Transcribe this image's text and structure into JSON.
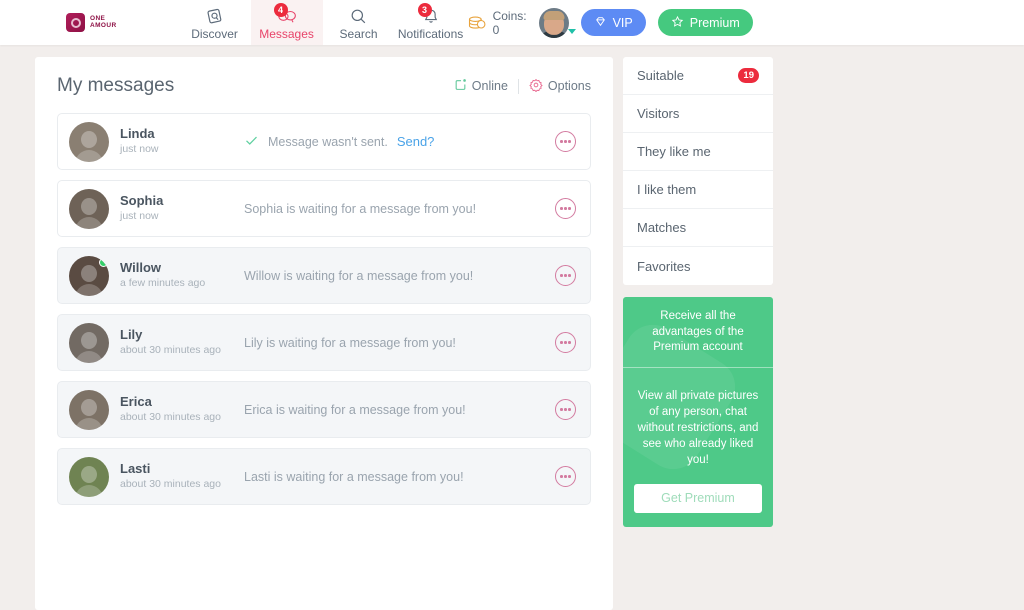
{
  "header": {
    "logo": {
      "line1": "ONE",
      "line2": "AMOUR",
      "icon": "one-amour-logo-icon"
    },
    "nav": [
      {
        "label": "Discover",
        "icon": "discover-icon",
        "badge": null,
        "active": false
      },
      {
        "label": "Messages",
        "icon": "messages-icon",
        "badge": "4",
        "active": true
      },
      {
        "label": "Search",
        "icon": "search-icon",
        "badge": null,
        "active": false
      },
      {
        "label": "Notifications",
        "icon": "bell-icon",
        "badge": "3",
        "active": false
      }
    ],
    "coins": {
      "label": "Coins: 0",
      "icon": "coins-icon"
    },
    "account": {
      "avatar": "user-avatar",
      "caret": "chevron-down-icon"
    },
    "vip_button": {
      "label": "VIP",
      "icon": "diamond-icon",
      "color": "#5d8bf4"
    },
    "premium_button": {
      "label": "Premium",
      "icon": "star-icon",
      "color": "#45c97f"
    }
  },
  "main": {
    "title": "My messages",
    "actions": [
      {
        "label": "Online",
        "icon": "online-toggle-icon",
        "color": "#62c89b"
      },
      {
        "label": "Options",
        "icon": "gear-icon",
        "color": "#e8688f"
      }
    ],
    "messages": [
      {
        "name": "Linda",
        "time": "just now",
        "text": "Message wasn't sent.",
        "link": "Send?",
        "check": true,
        "online": false,
        "unseen": false,
        "avatar_color": "#8a7f72"
      },
      {
        "name": "Sophia",
        "time": "just now",
        "text": "Sophia is waiting for a message from you!",
        "link": "",
        "check": false,
        "online": false,
        "unseen": false,
        "avatar_color": "#6e6257"
      },
      {
        "name": "Willow",
        "time": "a few minutes ago",
        "text": "Willow is waiting for a message from you!",
        "link": "",
        "check": false,
        "online": true,
        "unseen": true,
        "avatar_color": "#5a4b42"
      },
      {
        "name": "Lily",
        "time": "about 30 minutes ago",
        "text": "Lily is waiting for a message from you!",
        "link": "",
        "check": false,
        "online": false,
        "unseen": true,
        "avatar_color": "#726a63"
      },
      {
        "name": "Erica",
        "time": "about 30 minutes ago",
        "text": "Erica is waiting for a message from you!",
        "link": "",
        "check": false,
        "online": false,
        "unseen": true,
        "avatar_color": "#7d7266"
      },
      {
        "name": "Lasti",
        "time": "about 30 minutes ago",
        "text": "Lasti is waiting for a message from you!",
        "link": "",
        "check": false,
        "online": false,
        "unseen": true,
        "avatar_color": "#6f8352"
      }
    ],
    "more_icon": "more-options-icon"
  },
  "sidebar": {
    "items": [
      {
        "label": "Suitable",
        "badge": "19"
      },
      {
        "label": "Visitors",
        "badge": null
      },
      {
        "label": "They like me",
        "badge": null
      },
      {
        "label": "I like them",
        "badge": null
      },
      {
        "label": "Matches",
        "badge": null
      },
      {
        "label": "Favorites",
        "badge": null
      }
    ],
    "promo": {
      "heading": "Receive all the advantages of the Premium account",
      "body": "View all private pictures of any person, chat without restrictions, and see who already liked you!",
      "button": "Get Premium",
      "color": "#4ec988"
    }
  }
}
